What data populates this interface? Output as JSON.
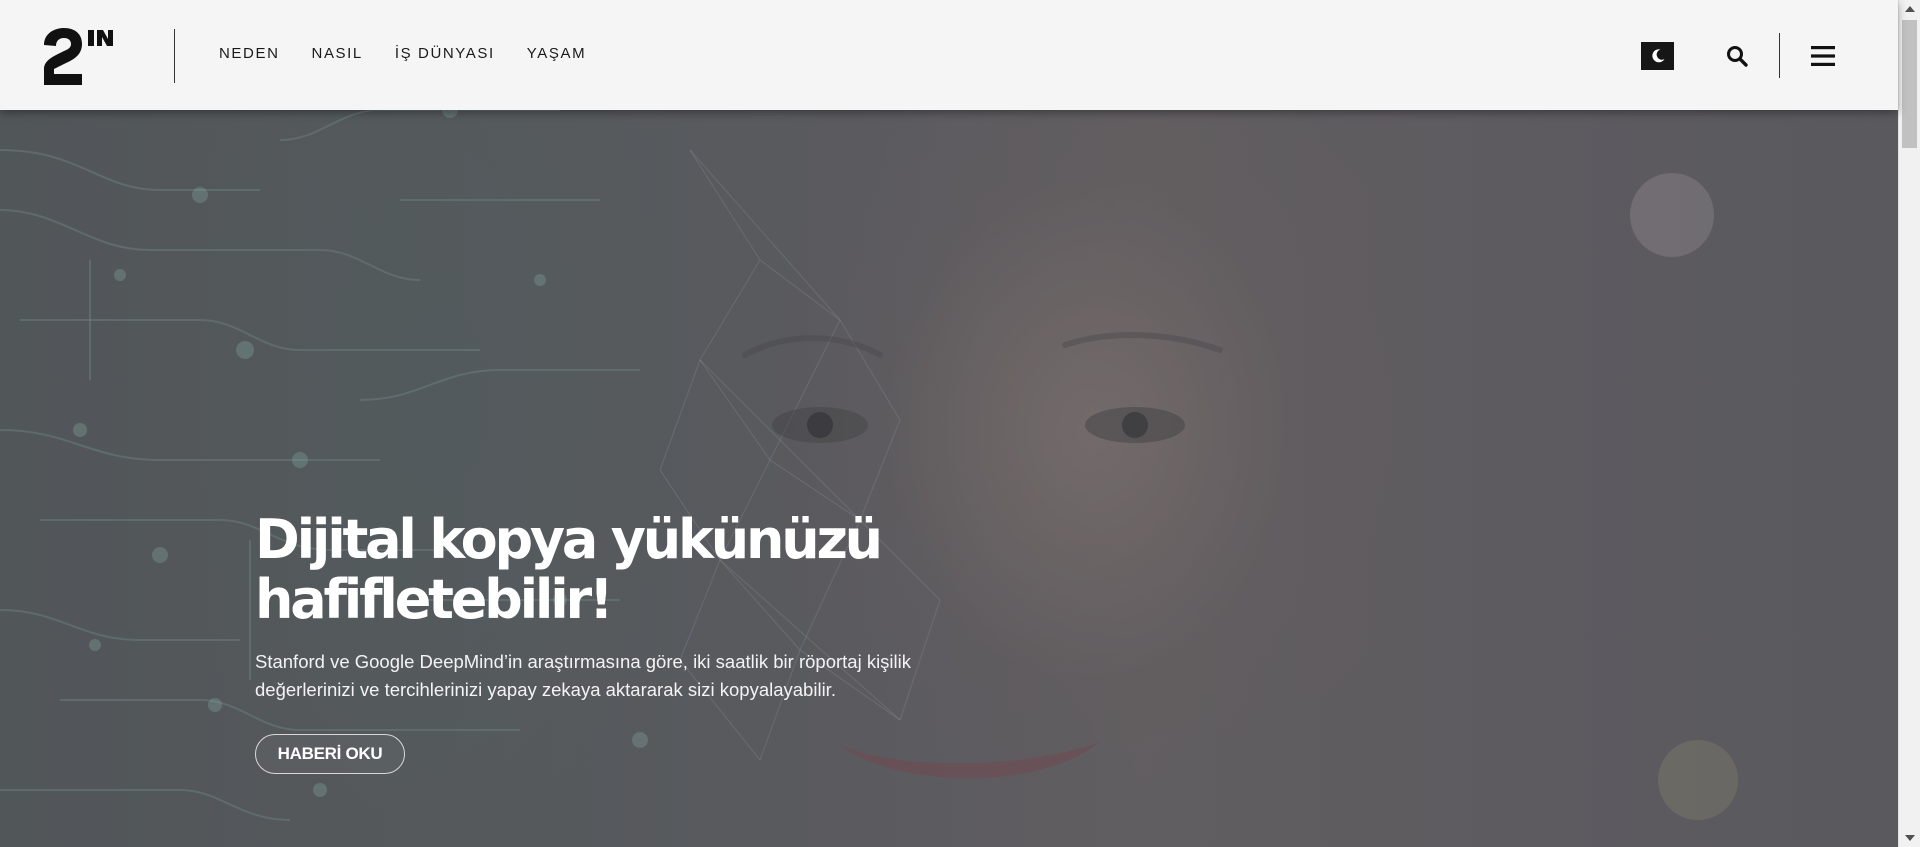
{
  "header": {
    "logo_alt": "2N",
    "nav": [
      {
        "label": "NEDEN"
      },
      {
        "label": "NASIL"
      },
      {
        "label": "İŞ DÜNYASI"
      },
      {
        "label": "YAŞAM"
      }
    ],
    "icons": {
      "theme_toggle": "moon-icon",
      "search": "search-icon",
      "menu": "hamburger-menu-icon"
    }
  },
  "hero": {
    "headline": "Dijital kopya yükünüzü hafifletebilir!",
    "summary": "Stanford ve Google DeepMind’in araştırmasına göre, iki saatlik bir röportaj kişilik değerlerinizi ve tercihlerinizi yapay zekaya aktararak sizi kopyalayabilir.",
    "cta_label": "HABERİ OKU"
  },
  "colors": {
    "header_bg": "#f5f5f5",
    "nav_text": "#1a1a1a",
    "toggle_bg": "#161616",
    "hero_text": "#ffffff"
  }
}
